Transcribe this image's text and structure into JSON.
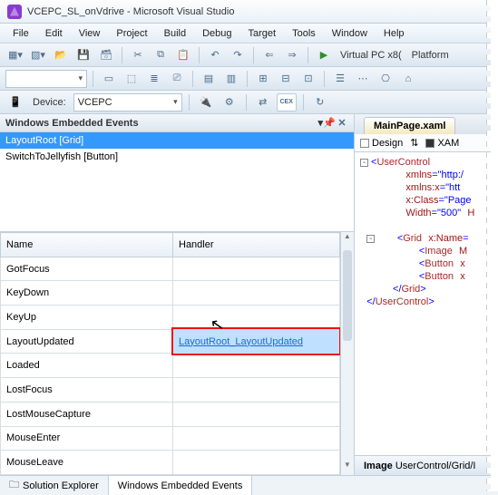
{
  "window": {
    "title": "VCEPC_SL_onVdrive - Microsoft Visual Studio"
  },
  "menu": {
    "items": [
      "File",
      "Edit",
      "View",
      "Project",
      "Build",
      "Debug",
      "Target",
      "Tools",
      "Window",
      "Help"
    ]
  },
  "toolbar1": {
    "virtualpc": "Virtual PC   x8(",
    "platform": "Platform"
  },
  "devicebar": {
    "label": "Device:",
    "value": "VCEPC"
  },
  "events_panel": {
    "title": "Windows Embedded Events",
    "items": [
      {
        "label": "LayoutRoot [Grid]",
        "selected": true
      },
      {
        "label": "SwitchToJellyfish [Button]",
        "selected": false
      }
    ]
  },
  "grid": {
    "cols": {
      "name": "Name",
      "handler": "Handler"
    },
    "rows": [
      {
        "name": "GotFocus",
        "handler": ""
      },
      {
        "name": "KeyDown",
        "handler": ""
      },
      {
        "name": "KeyUp",
        "handler": ""
      },
      {
        "name": "LayoutUpdated",
        "handler": "LayoutRoot_LayoutUpdated",
        "highlight": true
      },
      {
        "name": "Loaded",
        "handler": ""
      },
      {
        "name": "LostFocus",
        "handler": ""
      },
      {
        "name": "LostMouseCapture",
        "handler": ""
      },
      {
        "name": "MouseEnter",
        "handler": ""
      },
      {
        "name": "MouseLeave",
        "handler": ""
      }
    ]
  },
  "editor": {
    "tab": "MainPage.xaml",
    "designbar": {
      "design": "Design",
      "xaml": "XAM",
      "arrows": "⇅"
    }
  },
  "bottomtabs": {
    "solution": "Solution Explorer",
    "events": "Windows Embedded Events"
  },
  "statusbar": {
    "image": "Image",
    "path": "UserControl/Grid/I"
  }
}
